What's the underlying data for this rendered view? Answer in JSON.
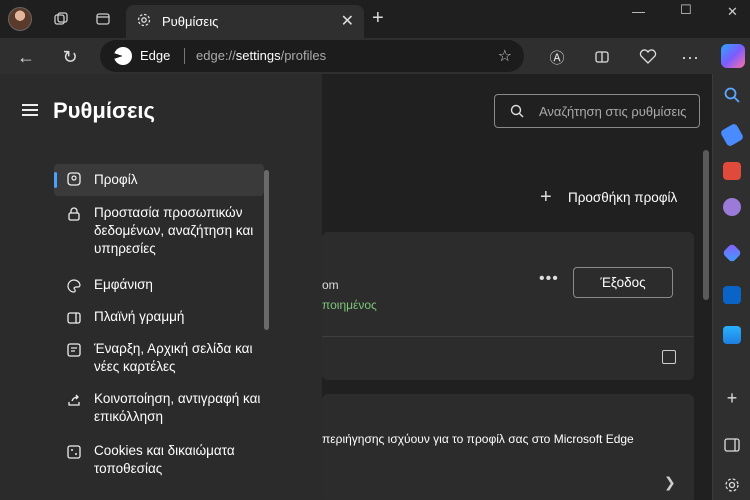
{
  "tab": {
    "title": "Ρυθμίσεις"
  },
  "address": {
    "site_label": "Edge",
    "url_prefix": "edge://",
    "url_strong": "settings",
    "url_suffix": "/profiles"
  },
  "settings": {
    "title": "Ρυθμίσεις",
    "search_placeholder": "Αναζήτηση στις ρυθμίσεις",
    "nav": [
      {
        "label": "Προφίλ"
      },
      {
        "label": "Προστασία προσωπικών δεδομένων, αναζήτηση και υπηρεσίες"
      },
      {
        "label": "Εμφάνιση"
      },
      {
        "label": "Πλαϊνή γραμμή"
      },
      {
        "label": "Έναρξη, Αρχική σελίδα και νέες καρτέλες"
      },
      {
        "label": "Κοινοποίηση, αντιγραφή και επικόλληση"
      },
      {
        "label": "Cookies και δικαιώματα τοποθεσίας"
      }
    ]
  },
  "main": {
    "add_profile": "Προσθήκη προφίλ",
    "email_fragment": "om",
    "sync_fragment": "ποιημένος",
    "signout": "Έξοδος",
    "info_text": "περιήγησης ισχύουν για το προφίλ σας στο Microsoft Edge"
  }
}
